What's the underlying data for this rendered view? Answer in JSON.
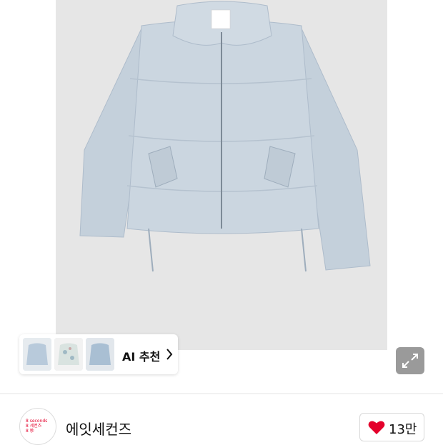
{
  "product": {
    "image_alt": "Light blue puffer jacket"
  },
  "ai_recommend": {
    "label": "AI 추천",
    "chevron_icon": "chevron-right-icon",
    "thumbnails": [
      "light-blue-puffer",
      "printed-puffer",
      "blue-puffer"
    ]
  },
  "expand_icon": "expand-icon",
  "seller": {
    "name": "에잇세컨즈",
    "logo_lines": [
      "8 seconds",
      "8 세컨즈",
      "8 秒"
    ]
  },
  "like": {
    "icon": "heart-icon",
    "count": "13만",
    "color": "#e4002b"
  },
  "colors": {
    "jacket": "#c8d4df",
    "photo_bg": "#e6e6e6",
    "accent": "#e4002b"
  }
}
